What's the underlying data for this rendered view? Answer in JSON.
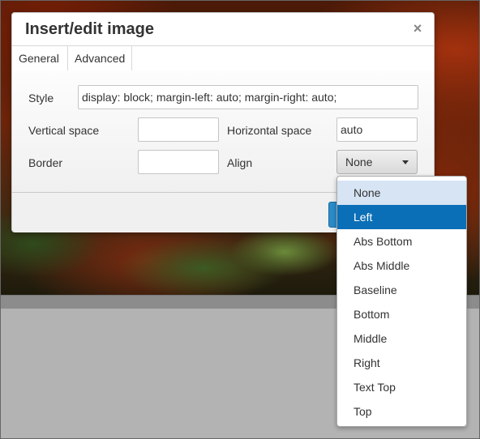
{
  "dialog": {
    "title": "Insert/edit image",
    "close_symbol": "×"
  },
  "tabs": [
    {
      "label": "General",
      "active": false
    },
    {
      "label": "Advanced",
      "active": true
    }
  ],
  "form": {
    "style_label": "Style",
    "style_value": "display: block; margin-left: auto; margin-right: auto;",
    "vspace_label": "Vertical space",
    "vspace_value": "",
    "hspace_label": "Horizontal space",
    "hspace_value": "auto",
    "border_label": "Border",
    "border_value": "",
    "align_label": "Align",
    "align_value": "None"
  },
  "align_menu": {
    "items": [
      "None",
      "Left",
      "Abs Bottom",
      "Abs Middle",
      "Baseline",
      "Bottom",
      "Middle",
      "Right",
      "Text Top",
      "Top"
    ],
    "hovered": "None",
    "selected": "Left"
  },
  "colors": {
    "accent": "#0b6fb7",
    "hover": "#d6e4f4",
    "ok_button": "#2d8ac7"
  },
  "icons": {
    "close": "close-icon",
    "dropdown": "chevron-down-icon"
  }
}
